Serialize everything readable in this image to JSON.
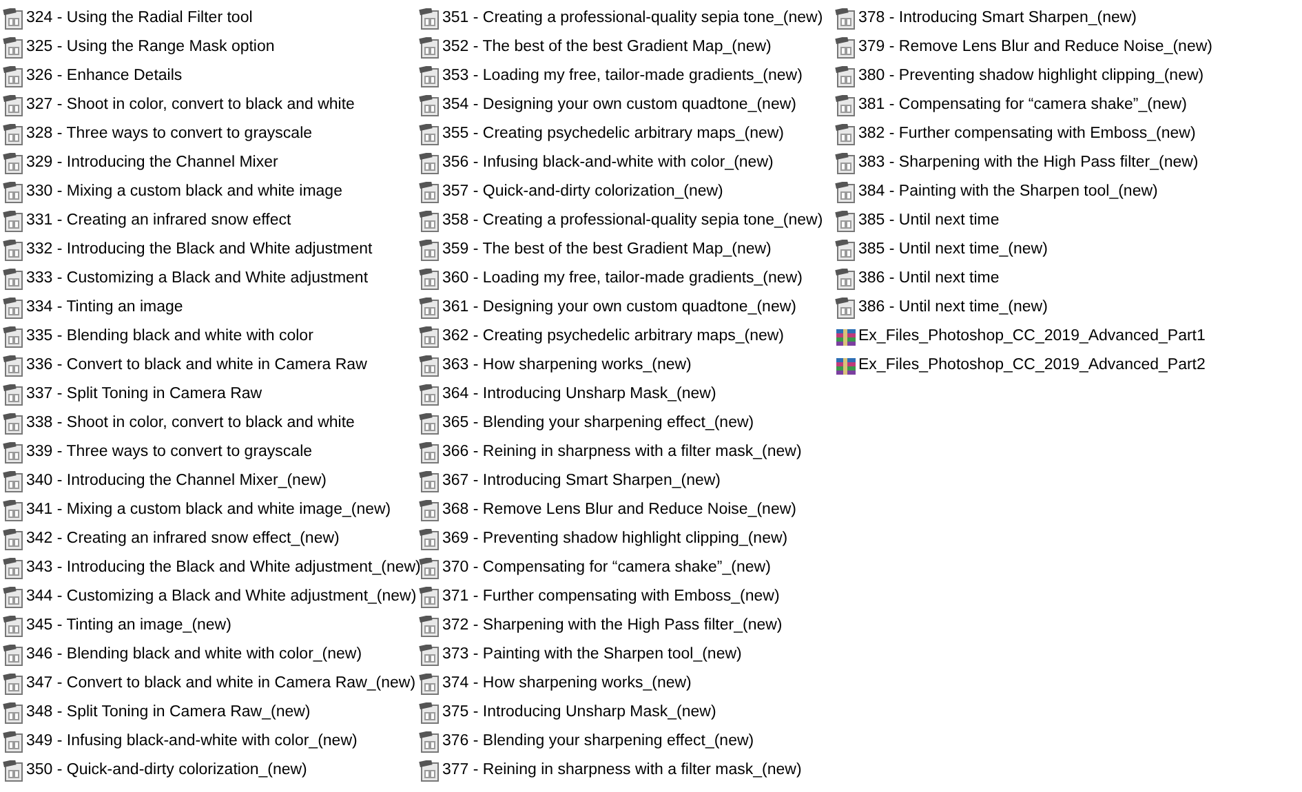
{
  "files": [
    {
      "kind": "video",
      "name": "324 - Using the Radial Filter tool"
    },
    {
      "kind": "video",
      "name": "325 - Using the Range Mask option"
    },
    {
      "kind": "video",
      "name": "326 - Enhance Details"
    },
    {
      "kind": "video",
      "name": "327 - Shoot in color, convert to black and white"
    },
    {
      "kind": "video",
      "name": "328 - Three ways to convert to grayscale"
    },
    {
      "kind": "video",
      "name": "329 - Introducing the Channel Mixer"
    },
    {
      "kind": "video",
      "name": "330 - Mixing a custom black and white image"
    },
    {
      "kind": "video",
      "name": "331 - Creating an infrared snow effect"
    },
    {
      "kind": "video",
      "name": "332 - Introducing the Black and White adjustment"
    },
    {
      "kind": "video",
      "name": "333 - Customizing a Black and White adjustment"
    },
    {
      "kind": "video",
      "name": "334 - Tinting an image"
    },
    {
      "kind": "video",
      "name": "335 - Blending black and white with color"
    },
    {
      "kind": "video",
      "name": "336 - Convert to black and white in Camera Raw"
    },
    {
      "kind": "video",
      "name": "337 - Split Toning in Camera Raw"
    },
    {
      "kind": "video",
      "name": "338 - Shoot in color, convert to black and white"
    },
    {
      "kind": "video",
      "name": "339 - Three ways to convert to grayscale"
    },
    {
      "kind": "video",
      "name": "340 - Introducing the Channel Mixer_(new)"
    },
    {
      "kind": "video",
      "name": "341 - Mixing a custom black and white image_(new)"
    },
    {
      "kind": "video",
      "name": "342 - Creating an infrared snow effect_(new)"
    },
    {
      "kind": "video",
      "name": "343 - Introducing the Black and White adjustment_(new)"
    },
    {
      "kind": "video",
      "name": "344 - Customizing a Black and White adjustment_(new)"
    },
    {
      "kind": "video",
      "name": "345 - Tinting an image_(new)"
    },
    {
      "kind": "video",
      "name": "346 - Blending black and white with color_(new)"
    },
    {
      "kind": "video",
      "name": "347 - Convert to black and white in Camera Raw_(new)"
    },
    {
      "kind": "video",
      "name": "348 - Split Toning in Camera Raw_(new)"
    },
    {
      "kind": "video",
      "name": "349 - Infusing black-and-white with color_(new)"
    },
    {
      "kind": "video",
      "name": "350 - Quick-and-dirty colorization_(new)"
    },
    {
      "kind": "video",
      "name": "351 - Creating a professional-quality sepia tone_(new)"
    },
    {
      "kind": "video",
      "name": "352 - The best of the best Gradient Map_(new)"
    },
    {
      "kind": "video",
      "name": "353 - Loading my free, tailor-made gradients_(new)"
    },
    {
      "kind": "video",
      "name": "354 - Designing your own custom quadtone_(new)"
    },
    {
      "kind": "video",
      "name": "355 - Creating psychedelic arbitrary maps_(new)"
    },
    {
      "kind": "video",
      "name": "356 - Infusing black-and-white with color_(new)"
    },
    {
      "kind": "video",
      "name": "357 - Quick-and-dirty colorization_(new)"
    },
    {
      "kind": "video",
      "name": "358 - Creating a professional-quality sepia tone_(new)"
    },
    {
      "kind": "video",
      "name": "359 - The best of the best Gradient Map_(new)"
    },
    {
      "kind": "video",
      "name": "360 - Loading my free, tailor-made gradients_(new)"
    },
    {
      "kind": "video",
      "name": "361 - Designing your own custom quadtone_(new)"
    },
    {
      "kind": "video",
      "name": "362 - Creating psychedelic arbitrary maps_(new)"
    },
    {
      "kind": "video",
      "name": "363 - How sharpening works_(new)"
    },
    {
      "kind": "video",
      "name": "364 - Introducing Unsharp Mask_(new)"
    },
    {
      "kind": "video",
      "name": "365 - Blending your sharpening effect_(new)"
    },
    {
      "kind": "video",
      "name": "366 - Reining in sharpness with a filter mask_(new)"
    },
    {
      "kind": "video",
      "name": "367 - Introducing Smart Sharpen_(new)"
    },
    {
      "kind": "video",
      "name": "368 - Remove Lens Blur and Reduce Noise_(new)"
    },
    {
      "kind": "video",
      "name": "369 - Preventing shadow highlight clipping_(new)"
    },
    {
      "kind": "video",
      "name": "370 - Compensating for “camera shake”_(new)"
    },
    {
      "kind": "video",
      "name": "371 - Further compensating with Emboss_(new)"
    },
    {
      "kind": "video",
      "name": "372 - Sharpening with the High Pass filter_(new)"
    },
    {
      "kind": "video",
      "name": "373 - Painting with the Sharpen tool_(new)"
    },
    {
      "kind": "video",
      "name": "374 - How sharpening works_(new)"
    },
    {
      "kind": "video",
      "name": "375 - Introducing Unsharp Mask_(new)"
    },
    {
      "kind": "video",
      "name": "376 - Blending your sharpening effect_(new)"
    },
    {
      "kind": "video",
      "name": "377 - Reining in sharpness with a filter mask_(new)"
    },
    {
      "kind": "video",
      "name": "378 - Introducing Smart Sharpen_(new)"
    },
    {
      "kind": "video",
      "name": "379 - Remove Lens Blur and Reduce Noise_(new)"
    },
    {
      "kind": "video",
      "name": "380 - Preventing shadow highlight clipping_(new)"
    },
    {
      "kind": "video",
      "name": "381 - Compensating for “camera shake”_(new)"
    },
    {
      "kind": "video",
      "name": "382 - Further compensating with Emboss_(new)"
    },
    {
      "kind": "video",
      "name": "383 - Sharpening with the High Pass filter_(new)"
    },
    {
      "kind": "video",
      "name": "384 - Painting with the Sharpen tool_(new)"
    },
    {
      "kind": "video",
      "name": "385 - Until next time"
    },
    {
      "kind": "video",
      "name": "385 - Until next time_(new)"
    },
    {
      "kind": "video",
      "name": "386 - Until next time"
    },
    {
      "kind": "video",
      "name": "386 - Until next time_(new)"
    },
    {
      "kind": "archive",
      "name": "Ex_Files_Photoshop_CC_2019_Advanced_Part1"
    },
    {
      "kind": "archive",
      "name": "Ex_Files_Photoshop_CC_2019_Advanced_Part2"
    }
  ]
}
